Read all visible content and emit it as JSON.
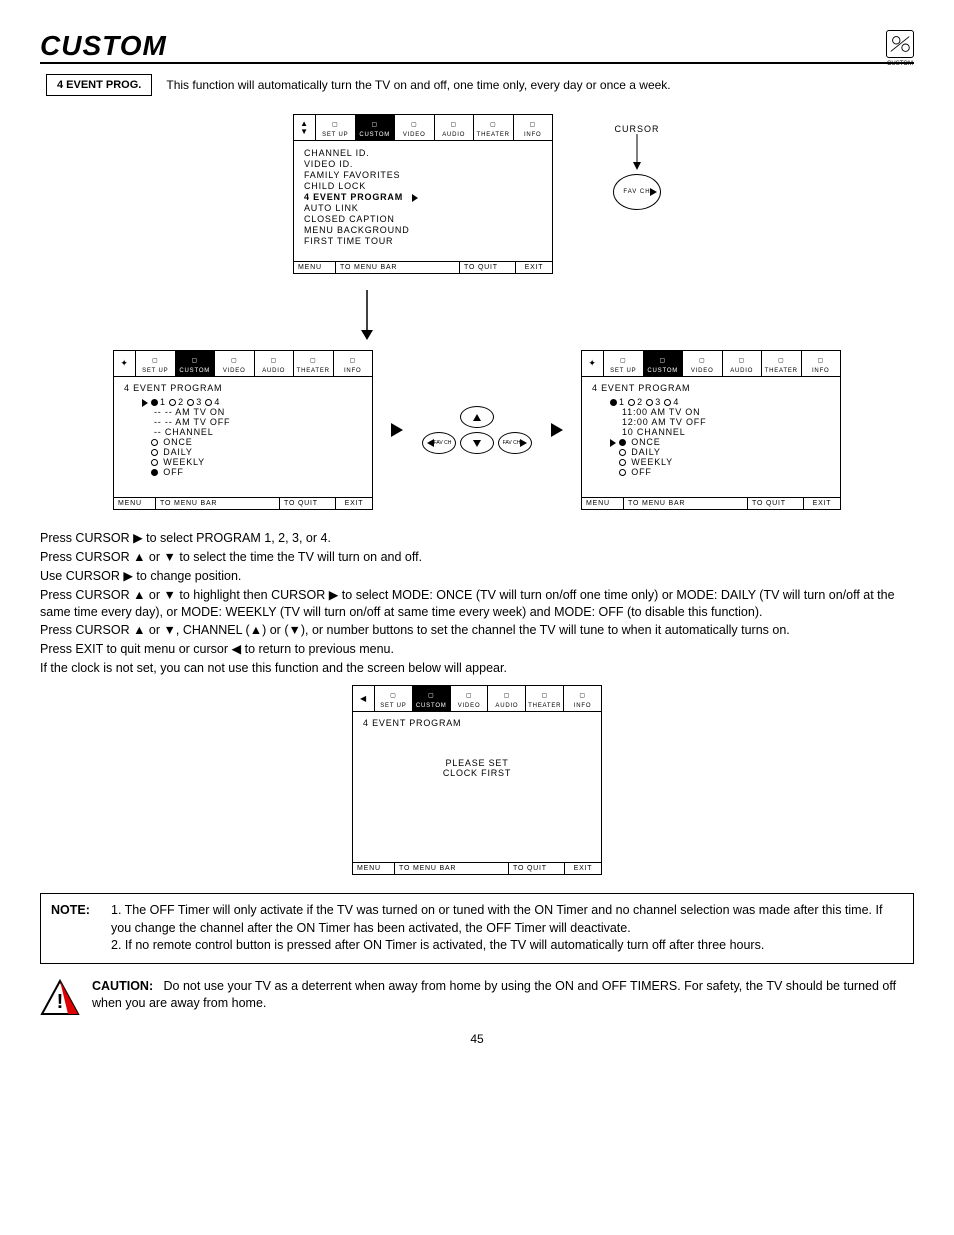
{
  "header": {
    "title": "CUSTOM",
    "corner_label": "CUSTOM"
  },
  "intro": {
    "box_label": "4 EVENT PROG.",
    "text": "This function will automatically turn the TV on and off, one time only, every day or once a week."
  },
  "tabs": [
    "SET UP",
    "CUSTOM",
    "VIDEO",
    "AUDIO",
    "THEATER",
    "INFO"
  ],
  "top_menu": {
    "items": [
      "CHANNEL ID.",
      "VIDEO ID.",
      "FAMILY FAVORITES",
      "CHILD LOCK",
      "4 EVENT PROGRAM",
      "AUTO LINK",
      "CLOSED CAPTION",
      "MENU BACKGROUND",
      "FIRST TIME TOUR"
    ],
    "selected": 4
  },
  "footer": {
    "f1": "MENU",
    "f2": "TO MENU BAR",
    "f3": "TO QUIT",
    "f4": "EXIT"
  },
  "cursor_label": "CURSOR",
  "fav_ch": "FAV CH",
  "left_prog": {
    "title": "4 EVENT PROGRAM",
    "nums": [
      "1",
      "2",
      "3",
      "4"
    ],
    "tv_on": "-- -- AM TV ON",
    "tv_off": "-- -- AM TV OFF",
    "channel": "-- CHANNEL",
    "modes": [
      "ONCE",
      "DAILY",
      "WEEKLY",
      "OFF"
    ],
    "selected_num": 0,
    "selected_mode": 3
  },
  "right_prog": {
    "title": "4 EVENT PROGRAM",
    "nums": [
      "1",
      "2",
      "3",
      "4"
    ],
    "tv_on": "11:00 AM TV ON",
    "tv_off": "12:00 AM TV OFF",
    "channel": "10 CHANNEL",
    "modes": [
      "ONCE",
      "DAILY",
      "WEEKLY",
      "OFF"
    ],
    "selected_num": 0,
    "selected_mode": 0
  },
  "instructions": {
    "l1": "Press CURSOR ▶ to select PROGRAM 1, 2, 3, or 4.",
    "l2": "Press CURSOR ▲ or ▼ to select the time the TV will turn on and off.",
    "l3": "Use CURSOR ▶ to change position.",
    "l4": "Press CURSOR ▲ or ▼ to highlight then CURSOR ▶ to select MODE: ONCE (TV will turn on/off one time only) or MODE: DAILY (TV will turn on/off at the same time every day), or MODE: WEEKLY (TV will turn on/off at same time every week) and MODE: OFF (to disable this function).",
    "l5": "Press CURSOR ▲ or ▼, CHANNEL (▲) or (▼), or number buttons to set the channel the TV will tune to when it automatically turns on.",
    "l6": "Press EXIT to quit menu or cursor ◀ to return to previous menu.",
    "l7": "If the clock is not set, you can not use this function and the screen below will appear."
  },
  "clock_screen": {
    "title": "4 EVENT PROGRAM",
    "msg1": "PLEASE SET",
    "msg2": "CLOCK FIRST"
  },
  "note": {
    "label": "NOTE:",
    "n1": "1. The OFF Timer will only activate if the TV was turned on or tuned with the ON Timer and no channel selection was made after this time.  If you change the channel after the ON Timer has been activated, the OFF Timer will deactivate.",
    "n2": "2. If no remote control button is pressed after ON Timer is activated, the TV will automatically turn off after three hours."
  },
  "caution": {
    "label": "CAUTION:",
    "text": "Do not use your TV as a deterrent when away from home by using the ON and OFF TIMERS.  For safety, the TV should be turned off when you are away from home."
  },
  "page_number": "45"
}
